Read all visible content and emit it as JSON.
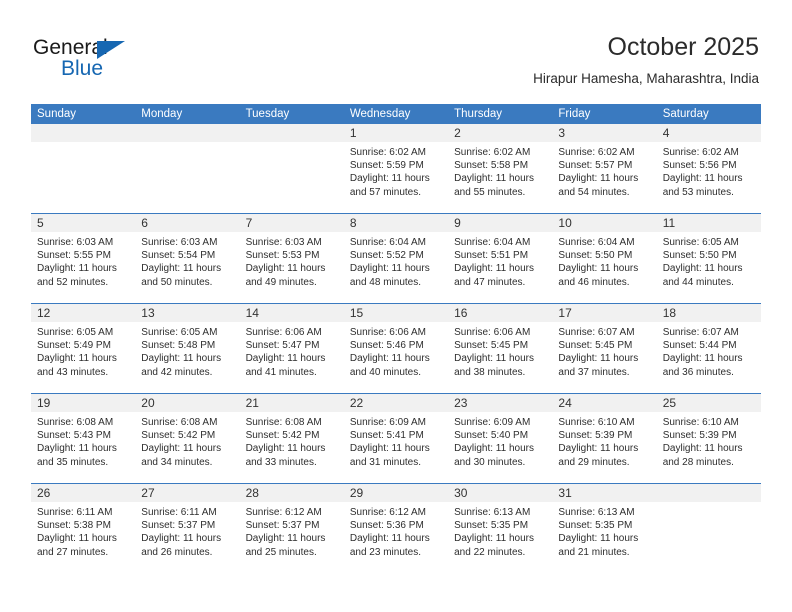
{
  "brand": {
    "name_part1": "General",
    "name_part2": "Blue",
    "triangle_color": "#1667b2"
  },
  "header": {
    "title": "October 2025",
    "subtitle": "Hirapur Hamesha, Maharashtra, India"
  },
  "theme": {
    "header_blue": "#3a7ac0",
    "strip_gray": "#f1f1f1",
    "text_dark": "#2e2e2e"
  },
  "weekdays": [
    "Sunday",
    "Monday",
    "Tuesday",
    "Wednesday",
    "Thursday",
    "Friday",
    "Saturday"
  ],
  "weeks": [
    [
      {
        "day": "",
        "sunrise": "",
        "sunset": "",
        "daylight_line1": "",
        "daylight_line2": ""
      },
      {
        "day": "",
        "sunrise": "",
        "sunset": "",
        "daylight_line1": "",
        "daylight_line2": ""
      },
      {
        "day": "",
        "sunrise": "",
        "sunset": "",
        "daylight_line1": "",
        "daylight_line2": ""
      },
      {
        "day": "1",
        "sunrise": "Sunrise: 6:02 AM",
        "sunset": "Sunset: 5:59 PM",
        "daylight_line1": "Daylight: 11 hours",
        "daylight_line2": "and 57 minutes."
      },
      {
        "day": "2",
        "sunrise": "Sunrise: 6:02 AM",
        "sunset": "Sunset: 5:58 PM",
        "daylight_line1": "Daylight: 11 hours",
        "daylight_line2": "and 55 minutes."
      },
      {
        "day": "3",
        "sunrise": "Sunrise: 6:02 AM",
        "sunset": "Sunset: 5:57 PM",
        "daylight_line1": "Daylight: 11 hours",
        "daylight_line2": "and 54 minutes."
      },
      {
        "day": "4",
        "sunrise": "Sunrise: 6:02 AM",
        "sunset": "Sunset: 5:56 PM",
        "daylight_line1": "Daylight: 11 hours",
        "daylight_line2": "and 53 minutes."
      }
    ],
    [
      {
        "day": "5",
        "sunrise": "Sunrise: 6:03 AM",
        "sunset": "Sunset: 5:55 PM",
        "daylight_line1": "Daylight: 11 hours",
        "daylight_line2": "and 52 minutes."
      },
      {
        "day": "6",
        "sunrise": "Sunrise: 6:03 AM",
        "sunset": "Sunset: 5:54 PM",
        "daylight_line1": "Daylight: 11 hours",
        "daylight_line2": "and 50 minutes."
      },
      {
        "day": "7",
        "sunrise": "Sunrise: 6:03 AM",
        "sunset": "Sunset: 5:53 PM",
        "daylight_line1": "Daylight: 11 hours",
        "daylight_line2": "and 49 minutes."
      },
      {
        "day": "8",
        "sunrise": "Sunrise: 6:04 AM",
        "sunset": "Sunset: 5:52 PM",
        "daylight_line1": "Daylight: 11 hours",
        "daylight_line2": "and 48 minutes."
      },
      {
        "day": "9",
        "sunrise": "Sunrise: 6:04 AM",
        "sunset": "Sunset: 5:51 PM",
        "daylight_line1": "Daylight: 11 hours",
        "daylight_line2": "and 47 minutes."
      },
      {
        "day": "10",
        "sunrise": "Sunrise: 6:04 AM",
        "sunset": "Sunset: 5:50 PM",
        "daylight_line1": "Daylight: 11 hours",
        "daylight_line2": "and 46 minutes."
      },
      {
        "day": "11",
        "sunrise": "Sunrise: 6:05 AM",
        "sunset": "Sunset: 5:50 PM",
        "daylight_line1": "Daylight: 11 hours",
        "daylight_line2": "and 44 minutes."
      }
    ],
    [
      {
        "day": "12",
        "sunrise": "Sunrise: 6:05 AM",
        "sunset": "Sunset: 5:49 PM",
        "daylight_line1": "Daylight: 11 hours",
        "daylight_line2": "and 43 minutes."
      },
      {
        "day": "13",
        "sunrise": "Sunrise: 6:05 AM",
        "sunset": "Sunset: 5:48 PM",
        "daylight_line1": "Daylight: 11 hours",
        "daylight_line2": "and 42 minutes."
      },
      {
        "day": "14",
        "sunrise": "Sunrise: 6:06 AM",
        "sunset": "Sunset: 5:47 PM",
        "daylight_line1": "Daylight: 11 hours",
        "daylight_line2": "and 41 minutes."
      },
      {
        "day": "15",
        "sunrise": "Sunrise: 6:06 AM",
        "sunset": "Sunset: 5:46 PM",
        "daylight_line1": "Daylight: 11 hours",
        "daylight_line2": "and 40 minutes."
      },
      {
        "day": "16",
        "sunrise": "Sunrise: 6:06 AM",
        "sunset": "Sunset: 5:45 PM",
        "daylight_line1": "Daylight: 11 hours",
        "daylight_line2": "and 38 minutes."
      },
      {
        "day": "17",
        "sunrise": "Sunrise: 6:07 AM",
        "sunset": "Sunset: 5:45 PM",
        "daylight_line1": "Daylight: 11 hours",
        "daylight_line2": "and 37 minutes."
      },
      {
        "day": "18",
        "sunrise": "Sunrise: 6:07 AM",
        "sunset": "Sunset: 5:44 PM",
        "daylight_line1": "Daylight: 11 hours",
        "daylight_line2": "and 36 minutes."
      }
    ],
    [
      {
        "day": "19",
        "sunrise": "Sunrise: 6:08 AM",
        "sunset": "Sunset: 5:43 PM",
        "daylight_line1": "Daylight: 11 hours",
        "daylight_line2": "and 35 minutes."
      },
      {
        "day": "20",
        "sunrise": "Sunrise: 6:08 AM",
        "sunset": "Sunset: 5:42 PM",
        "daylight_line1": "Daylight: 11 hours",
        "daylight_line2": "and 34 minutes."
      },
      {
        "day": "21",
        "sunrise": "Sunrise: 6:08 AM",
        "sunset": "Sunset: 5:42 PM",
        "daylight_line1": "Daylight: 11 hours",
        "daylight_line2": "and 33 minutes."
      },
      {
        "day": "22",
        "sunrise": "Sunrise: 6:09 AM",
        "sunset": "Sunset: 5:41 PM",
        "daylight_line1": "Daylight: 11 hours",
        "daylight_line2": "and 31 minutes."
      },
      {
        "day": "23",
        "sunrise": "Sunrise: 6:09 AM",
        "sunset": "Sunset: 5:40 PM",
        "daylight_line1": "Daylight: 11 hours",
        "daylight_line2": "and 30 minutes."
      },
      {
        "day": "24",
        "sunrise": "Sunrise: 6:10 AM",
        "sunset": "Sunset: 5:39 PM",
        "daylight_line1": "Daylight: 11 hours",
        "daylight_line2": "and 29 minutes."
      },
      {
        "day": "25",
        "sunrise": "Sunrise: 6:10 AM",
        "sunset": "Sunset: 5:39 PM",
        "daylight_line1": "Daylight: 11 hours",
        "daylight_line2": "and 28 minutes."
      }
    ],
    [
      {
        "day": "26",
        "sunrise": "Sunrise: 6:11 AM",
        "sunset": "Sunset: 5:38 PM",
        "daylight_line1": "Daylight: 11 hours",
        "daylight_line2": "and 27 minutes."
      },
      {
        "day": "27",
        "sunrise": "Sunrise: 6:11 AM",
        "sunset": "Sunset: 5:37 PM",
        "daylight_line1": "Daylight: 11 hours",
        "daylight_line2": "and 26 minutes."
      },
      {
        "day": "28",
        "sunrise": "Sunrise: 6:12 AM",
        "sunset": "Sunset: 5:37 PM",
        "daylight_line1": "Daylight: 11 hours",
        "daylight_line2": "and 25 minutes."
      },
      {
        "day": "29",
        "sunrise": "Sunrise: 6:12 AM",
        "sunset": "Sunset: 5:36 PM",
        "daylight_line1": "Daylight: 11 hours",
        "daylight_line2": "and 23 minutes."
      },
      {
        "day": "30",
        "sunrise": "Sunrise: 6:13 AM",
        "sunset": "Sunset: 5:35 PM",
        "daylight_line1": "Daylight: 11 hours",
        "daylight_line2": "and 22 minutes."
      },
      {
        "day": "31",
        "sunrise": "Sunrise: 6:13 AM",
        "sunset": "Sunset: 5:35 PM",
        "daylight_line1": "Daylight: 11 hours",
        "daylight_line2": "and 21 minutes."
      },
      {
        "day": "",
        "sunrise": "",
        "sunset": "",
        "daylight_line1": "",
        "daylight_line2": ""
      }
    ]
  ]
}
